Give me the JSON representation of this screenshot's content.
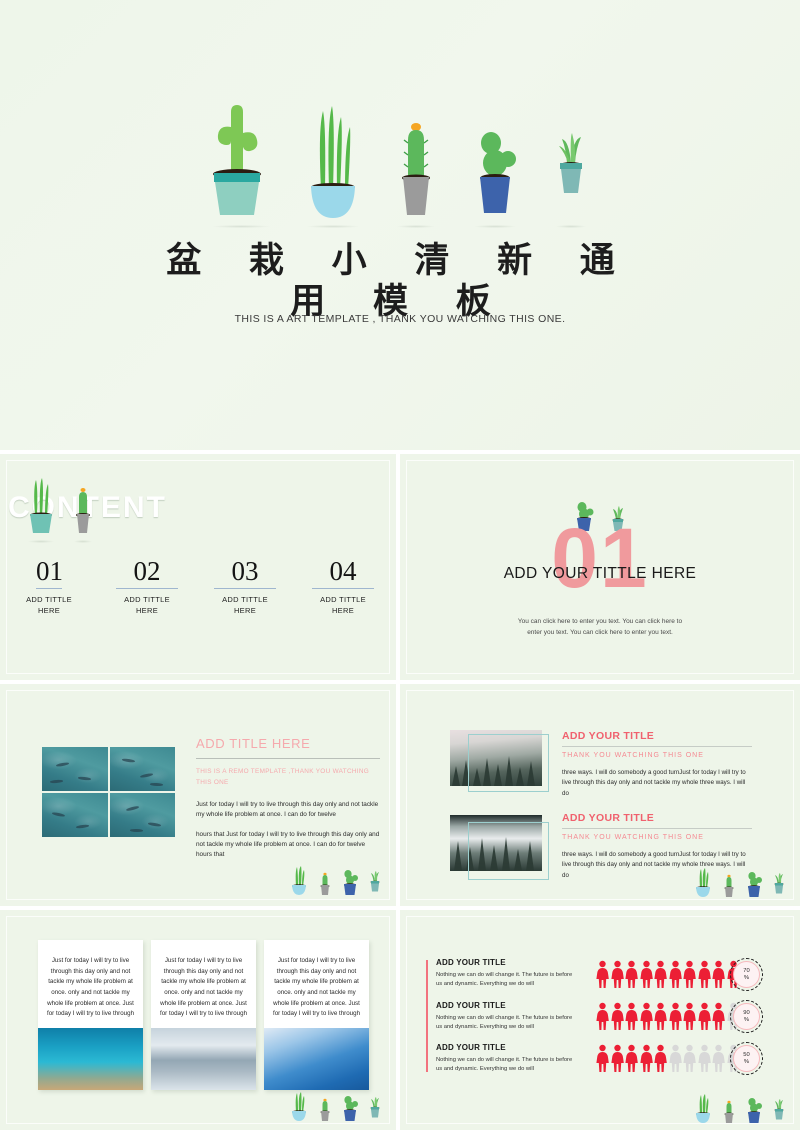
{
  "hero": {
    "title": "盆 栽 小 清 新 通 用 模 板",
    "subtitle": "THIS IS A ART TEMPLATE , THANK YOU WATCHING THIS ONE.",
    "plants": [
      "tall-cactus-teal-pot",
      "grass-blue-bowl",
      "flower-cactus-gray-pot",
      "arm-cactus-blue-pot",
      "succulent-teal-pot"
    ]
  },
  "content_slide": {
    "heading": "CONTENT",
    "items": [
      {
        "number": "01",
        "label": "ADD TITTLE HERE"
      },
      {
        "number": "02",
        "label": "ADD TITTLE HERE"
      },
      {
        "number": "03",
        "label": "ADD TITTLE HERE"
      },
      {
        "number": "04",
        "label": "ADD TITTLE HERE"
      }
    ]
  },
  "section_slide": {
    "big_number": "01",
    "title": "ADD YOUR TITTLE HERE",
    "body": "You can click here to enter you text. You can click here to enter you text. You can click here to enter you text."
  },
  "gallery_slide": {
    "title": "ADD TITLE HERE",
    "subtitle": "THIS IS A REMO TEMPLATE ,THANK YOU WATCHING THIS ONE",
    "paragraph1": "Just for today I will try to live through this day only and not tackle my whole life problem at once. I can do for twelve",
    "paragraph2": "hours that Just for today I will try to live through this day only and not tackle my whole life problem at once. I can do for twelve hours that",
    "image_caption": "underwater-fish-grid"
  },
  "forest_slide": {
    "blocks": [
      {
        "title": "ADD YOUR TITLE",
        "subtitle": "THANK YOU WATCHING THIS ONE",
        "body": "three ways. I will do somebody a good turnJust for today I will try to live through this day only and not tackle my whole three ways. I will do",
        "image_caption": "misty-forest"
      },
      {
        "title": "ADD YOUR TITLE",
        "subtitle": "THANK YOU WATCHING THIS ONE",
        "body": "three ways. I will do somebody a good turnJust for today I will try to live through this day only and not tackle my whole three ways. I will do",
        "image_caption": "foggy-pine-forest"
      }
    ]
  },
  "cards_slide": {
    "cards": [
      {
        "text": "Just for today I will try to live through this day only and not tackle my whole life problem at once. only and not tackle my whole life problem at once. Just for today I will try to live through",
        "image_caption": "turquoise-sea-shore"
      },
      {
        "text": "Just for today I will try to live through this day only and not tackle my whole life problem at once. only and not tackle my whole life problem at once. Just for today I will try to live through",
        "image_caption": "winter-lake-reflection"
      },
      {
        "text": "Just for today I will try to live through this day only and not tackle my whole life problem at once. only and not tackle my whole life problem at once. Just for today I will try to live through",
        "image_caption": "blue-sky-glacier"
      }
    ]
  },
  "info_slide": {
    "items": [
      {
        "title": "ADD YOUR TITLE",
        "desc": "Nothing we can do will  change it. The future is before us and dynamic. Everything we do will"
      },
      {
        "title": "ADD YOUR TITLE",
        "desc": "Nothing we can do will  change it. The future is before us and dynamic. Everything we do will"
      },
      {
        "title": "ADD YOUR TITLE",
        "desc": "Nothing we can do will  change it. The future is before us and dynamic. Everything we do will"
      }
    ]
  },
  "chart_data": {
    "type": "bar",
    "title": "",
    "categories": [
      "ADD YOUR TITLE",
      "ADD YOUR TITLE",
      "ADD YOUR TITLE"
    ],
    "values": [
      70,
      90,
      50
    ],
    "unit": "%",
    "pictogram": {
      "icon": "person-icon",
      "total_per_row": 10,
      "filled_per_row": [
        10,
        9,
        5
      ],
      "filled_color": "#ec1f35",
      "empty_color": "#d8d8d8"
    },
    "badges": [
      {
        "value": "70",
        "unit": "%"
      },
      {
        "value": "90",
        "unit": "%"
      },
      {
        "value": "50",
        "unit": "%"
      }
    ],
    "xlabel": "",
    "ylabel": "",
    "ylim": [
      0,
      100
    ]
  },
  "colors": {
    "background": "#eef5e9",
    "accent_pink": "#f09a9d",
    "accent_red": "#ec1f35",
    "title_pink": "#f0616e",
    "teal": "#6fc2b4",
    "gray_pot": "#9b9b9b",
    "blue_pot": "#3d63ab"
  }
}
